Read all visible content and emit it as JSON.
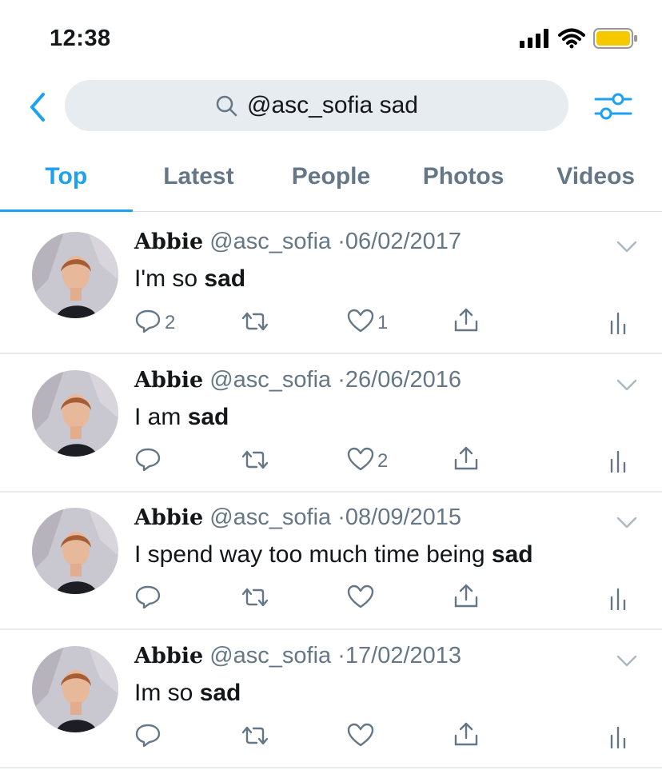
{
  "status_bar": {
    "time": "12:38"
  },
  "search": {
    "query": "@asc_sofia sad"
  },
  "tabs": [
    {
      "label": "Top"
    },
    {
      "label": "Latest"
    },
    {
      "label": "People"
    },
    {
      "label": "Photos"
    },
    {
      "label": "Videos"
    }
  ],
  "tweets": [
    {
      "name": "Abbie",
      "handle": "@asc_sofia",
      "date": "06/02/2017",
      "text_before": "I'm so ",
      "text_bold": "sad",
      "text_after": "",
      "replies": "2",
      "retweets": "",
      "likes": "1"
    },
    {
      "name": "Abbie",
      "handle": "@asc_sofia",
      "date": "26/06/2016",
      "text_before": "I am ",
      "text_bold": "sad",
      "text_after": "",
      "replies": "",
      "retweets": "",
      "likes": "2"
    },
    {
      "name": "Abbie",
      "handle": "@asc_sofia",
      "date": "08/09/2015",
      "text_before": "I spend way too much time being ",
      "text_bold": "sad",
      "text_after": "",
      "replies": "",
      "retweets": "",
      "likes": ""
    },
    {
      "name": "Abbie",
      "handle": "@asc_sofia",
      "date": "17/02/2013",
      "text_before": "Im so ",
      "text_bold": "sad",
      "text_after": "",
      "replies": "",
      "retweets": "",
      "likes": ""
    }
  ],
  "colors": {
    "accent": "#1da1f2",
    "secondary_text": "#657786",
    "battery": "#f6c800"
  },
  "icons": [
    "back-chevron-icon",
    "search-icon",
    "filter-sliders-icon",
    "reply-icon",
    "retweet-icon",
    "like-icon",
    "share-icon",
    "analytics-icon",
    "chevron-down-icon"
  ]
}
